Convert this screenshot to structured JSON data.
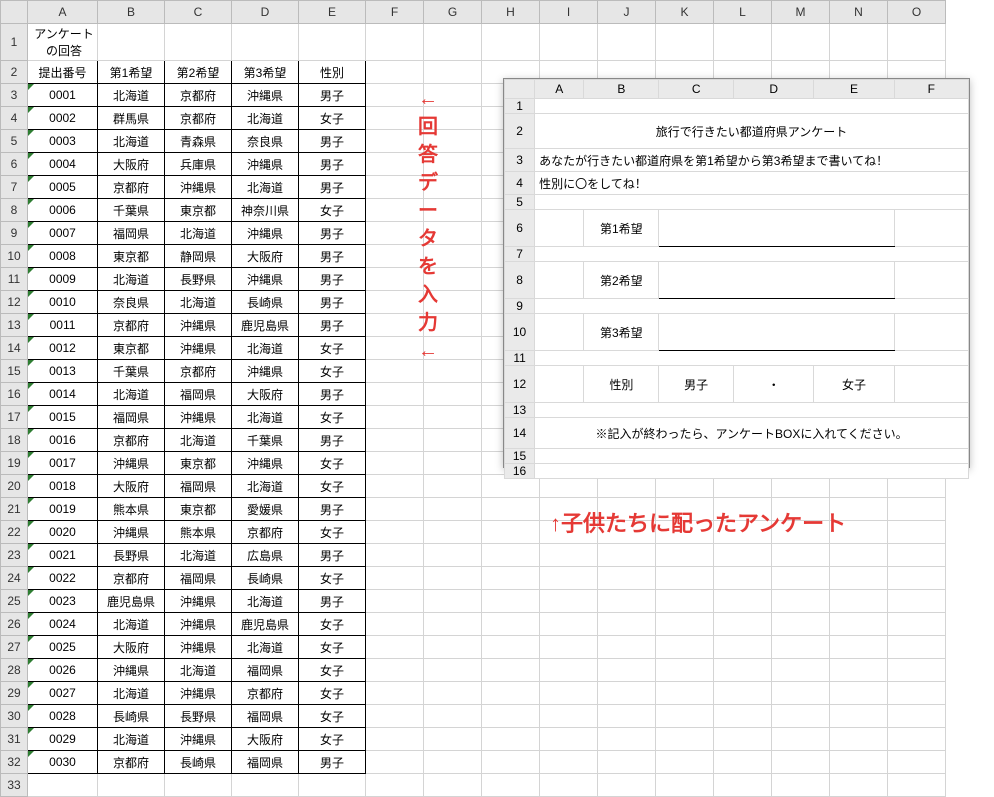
{
  "columns": [
    "A",
    "B",
    "C",
    "D",
    "E",
    "F",
    "G",
    "H",
    "I",
    "J",
    "K",
    "L",
    "M",
    "N",
    "O"
  ],
  "title": "アンケートの回答",
  "headers": [
    "提出番号",
    "第1希望",
    "第2希望",
    "第3希望",
    "性別"
  ],
  "rows": [
    {
      "no": "0001",
      "c1": "北海道",
      "c2": "京都府",
      "c3": "沖縄県",
      "g": "男子"
    },
    {
      "no": "0002",
      "c1": "群馬県",
      "c2": "京都府",
      "c3": "北海道",
      "g": "女子"
    },
    {
      "no": "0003",
      "c1": "北海道",
      "c2": "青森県",
      "c3": "奈良県",
      "g": "男子"
    },
    {
      "no": "0004",
      "c1": "大阪府",
      "c2": "兵庫県",
      "c3": "沖縄県",
      "g": "男子"
    },
    {
      "no": "0005",
      "c1": "京都府",
      "c2": "沖縄県",
      "c3": "北海道",
      "g": "男子"
    },
    {
      "no": "0006",
      "c1": "千葉県",
      "c2": "東京都",
      "c3": "神奈川県",
      "g": "女子"
    },
    {
      "no": "0007",
      "c1": "福岡県",
      "c2": "北海道",
      "c3": "沖縄県",
      "g": "男子"
    },
    {
      "no": "0008",
      "c1": "東京都",
      "c2": "静岡県",
      "c3": "大阪府",
      "g": "男子"
    },
    {
      "no": "0009",
      "c1": "北海道",
      "c2": "長野県",
      "c3": "沖縄県",
      "g": "男子"
    },
    {
      "no": "0010",
      "c1": "奈良県",
      "c2": "北海道",
      "c3": "長崎県",
      "g": "男子"
    },
    {
      "no": "0011",
      "c1": "京都府",
      "c2": "沖縄県",
      "c3": "鹿児島県",
      "g": "男子"
    },
    {
      "no": "0012",
      "c1": "東京都",
      "c2": "沖縄県",
      "c3": "北海道",
      "g": "女子"
    },
    {
      "no": "0013",
      "c1": "千葉県",
      "c2": "京都府",
      "c3": "沖縄県",
      "g": "女子"
    },
    {
      "no": "0014",
      "c1": "北海道",
      "c2": "福岡県",
      "c3": "大阪府",
      "g": "男子"
    },
    {
      "no": "0015",
      "c1": "福岡県",
      "c2": "沖縄県",
      "c3": "北海道",
      "g": "女子"
    },
    {
      "no": "0016",
      "c1": "京都府",
      "c2": "北海道",
      "c3": "千葉県",
      "g": "男子"
    },
    {
      "no": "0017",
      "c1": "沖縄県",
      "c2": "東京都",
      "c3": "沖縄県",
      "g": "女子"
    },
    {
      "no": "0018",
      "c1": "大阪府",
      "c2": "福岡県",
      "c3": "北海道",
      "g": "女子"
    },
    {
      "no": "0019",
      "c1": "熊本県",
      "c2": "東京都",
      "c3": "愛媛県",
      "g": "男子"
    },
    {
      "no": "0020",
      "c1": "沖縄県",
      "c2": "熊本県",
      "c3": "京都府",
      "g": "女子"
    },
    {
      "no": "0021",
      "c1": "長野県",
      "c2": "北海道",
      "c3": "広島県",
      "g": "男子"
    },
    {
      "no": "0022",
      "c1": "京都府",
      "c2": "福岡県",
      "c3": "長崎県",
      "g": "女子"
    },
    {
      "no": "0023",
      "c1": "鹿児島県",
      "c2": "沖縄県",
      "c3": "北海道",
      "g": "男子"
    },
    {
      "no": "0024",
      "c1": "北海道",
      "c2": "沖縄県",
      "c3": "鹿児島県",
      "g": "女子"
    },
    {
      "no": "0025",
      "c1": "大阪府",
      "c2": "沖縄県",
      "c3": "北海道",
      "g": "女子"
    },
    {
      "no": "0026",
      "c1": "沖縄県",
      "c2": "北海道",
      "c3": "福岡県",
      "g": "女子"
    },
    {
      "no": "0027",
      "c1": "北海道",
      "c2": "沖縄県",
      "c3": "京都府",
      "g": "女子"
    },
    {
      "no": "0028",
      "c1": "長崎県",
      "c2": "長野県",
      "c3": "福岡県",
      "g": "女子"
    },
    {
      "no": "0029",
      "c1": "北海道",
      "c2": "沖縄県",
      "c3": "大阪府",
      "g": "女子"
    },
    {
      "no": "0030",
      "c1": "京都府",
      "c2": "長崎県",
      "c3": "福岡県",
      "g": "男子"
    }
  ],
  "annotation_top_arrow": "←",
  "annotation_vertical": "回答データを入力",
  "annotation_bottom_arrow": "←",
  "form": {
    "cols": [
      "A",
      "B",
      "C",
      "D",
      "E",
      "F"
    ],
    "title": "旅行で行きたい都道府県アンケート",
    "line1": "あなたが行きたい都道府県を第1希望から第3希望まで書いてね！",
    "line2": "性別に〇をしてね！",
    "pref1": "第1希望",
    "pref2": "第2希望",
    "pref3": "第3希望",
    "gender_label": "性別",
    "gender_m": "男子",
    "gender_dot": "・",
    "gender_f": "女子",
    "note": "※記入が終わったら、アンケートBOXに入れてください。"
  },
  "caption": "↑子供たちに配ったアンケート"
}
